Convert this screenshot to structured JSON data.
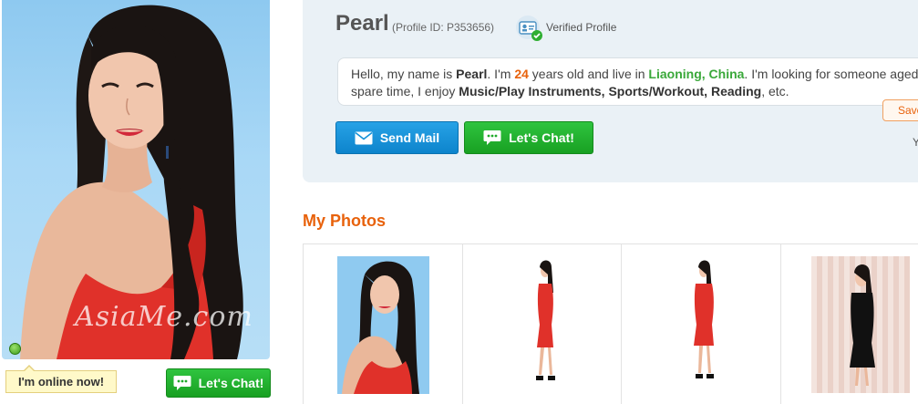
{
  "profile": {
    "name": "Pearl",
    "profile_id": "(Profile ID: P353656)",
    "verified_label": "Verified Profile",
    "watermark": "AsiaMe.com"
  },
  "status": {
    "online_text": "I'm online now!"
  },
  "bio": {
    "p1": "Hello, my name is ",
    "name": "Pearl",
    "p2": ". I'm ",
    "age": "24",
    "p3": " years old and live in ",
    "location": "Liaoning, China",
    "p4": ". I'm looking for someone aged",
    "p5": "spare time, I enjoy ",
    "interests": "Music/Play Instruments, Sports/Workout, Reading",
    "p6": ", etc."
  },
  "buttons": {
    "send_mail": "Send Mail",
    "lets_chat": "Let's Chat!",
    "lets_chat_side": "Let's Chat!",
    "save": "Save",
    "partial_text": "Y"
  },
  "photos": {
    "title": "My Photos"
  },
  "colors": {
    "accent_orange": "#e8620c",
    "green": "#1faa2a",
    "blue": "#1592d8",
    "panel": "#eaf1f6"
  }
}
